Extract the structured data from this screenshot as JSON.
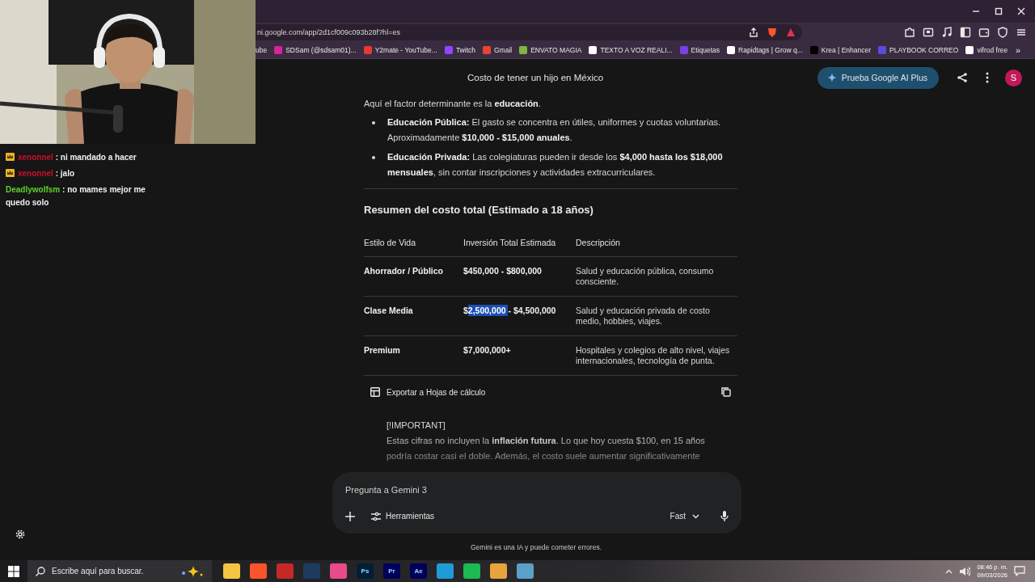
{
  "address_bar": {
    "url": "ni.google.com/app/2d1cf009c093b28f?hl=es"
  },
  "bookmarks": [
    {
      "label": "ube"
    },
    {
      "label": "SDSam (@sdsam01)...",
      "color": "#d6249f"
    },
    {
      "label": "Y2mate - YouTube...",
      "color": "#e53935"
    },
    {
      "label": "Twitch",
      "color": "#9146ff"
    },
    {
      "label": "Gmail",
      "color": "#ea4335"
    },
    {
      "label": "ENVATO MAGIA",
      "color": "#82b541"
    },
    {
      "label": "TEXTO A VOZ REALI...",
      "color": "#ffffff"
    },
    {
      "label": "Etiquetas",
      "color": "#7b3fe4"
    },
    {
      "label": "Rapidtags | Grow q...",
      "color": "#ffffff"
    },
    {
      "label": "Krea | Enhancer",
      "color": "#000000"
    },
    {
      "label": "PLAYBOOK CORREO",
      "color": "#5b4bdb"
    },
    {
      "label": "vifrod free",
      "color": "#ffffff"
    }
  ],
  "bookmarks_more": "»",
  "chat": {
    "messages": [
      {
        "badge": true,
        "user": "xenonnel",
        "color": "#c8102e",
        "text": ": ni mandado a hacer"
      },
      {
        "badge": true,
        "user": "xenonnel",
        "color": "#c8102e",
        "text": ": jalo"
      },
      {
        "badge": false,
        "user": "Deadlywolfsm",
        "color": "#5bd12a",
        "text": ": no mames mejor me quedo solo"
      }
    ]
  },
  "app": {
    "title": "Costo de tener un hijo en México",
    "upgrade_button": "Prueba Google AI Plus",
    "avatar": "S"
  },
  "content": {
    "intro": "Aquí el factor determinante es la **educación**.",
    "bullets": [
      "**Educación Pública:** El gasto se concentra en útiles, uniformes y cuotas voluntarias. Aproximadamente **$10,000 - $15,000 anuales**.",
      "**Educación Privada:** Las colegiaturas pueden ir desde los **$4,000 hasta los $18,000 mensuales**, sin contar inscripciones y actividades extracurriculares."
    ],
    "heading": "Resumen del costo total (Estimado a 18 años)",
    "table": {
      "columns": [
        "Estilo de Vida",
        "Inversión Total Estimada",
        "Descripción"
      ],
      "rows": [
        [
          {
            "text": "Ahorrador / Público"
          },
          {
            "text": "$450,000 - $800,000"
          },
          {
            "text": "Salud y educación pública, consumo consciente."
          }
        ],
        [
          {
            "text": "Clase Media"
          },
          {
            "parts": [
              {
                "text": "$",
                "highlighted": false
              },
              {
                "text": "2,500,000 ",
                "highlighted": true
              },
              {
                "text": "- $4,500,000",
                "highlighted": false
              }
            ]
          },
          {
            "text": "Salud y educación privada de costo medio, hobbies, viajes."
          }
        ],
        [
          {
            "text": "Premium"
          },
          {
            "text": "$7,000,000+"
          },
          {
            "text": "Hospitales y colegios de alto nivel, viajes internacionales, tecnología de punta."
          }
        ]
      ]
    },
    "export": "Exportar a Hojas de cálculo",
    "note": {
      "tag": "[!IMPORTANT]",
      "text": "Estas cifras no incluyen la **inflación futura**. Lo que hoy cuesta $100, en 15 años podría costar casi el doble. Además, el costo suele aumentar significativamente"
    }
  },
  "composer": {
    "placeholder": "Pregunta a Gemini 3",
    "tools": "Herramientas",
    "model": "Fast"
  },
  "disclaimer": "Gemini es una IA y puede cometer errores.",
  "taskbar": {
    "search_placeholder": "Escribe aquí para buscar.",
    "apps": [
      {
        "color": "#f4c542"
      },
      {
        "color": "#fb542b"
      },
      {
        "color": "#c62828"
      },
      {
        "color": "#1e3a5f"
      },
      {
        "color": "#e94b8a"
      },
      {
        "label": "Ps",
        "color": "#001e36"
      },
      {
        "label": "Pr",
        "color": "#00005b"
      },
      {
        "label": "Ae",
        "color": "#00005b"
      },
      {
        "color": "#1f9bd7"
      },
      {
        "color": "#1db954"
      },
      {
        "color": "#e8a33d"
      },
      {
        "color": "#5aa0c8"
      }
    ],
    "time": "08:46 p. m.",
    "date": "09/03/2026"
  }
}
